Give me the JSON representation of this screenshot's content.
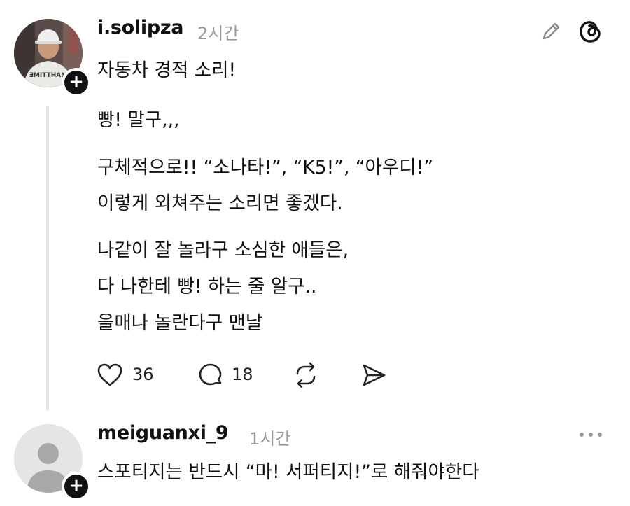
{
  "post": {
    "username": "i.solipza",
    "time": "2시간",
    "lines": {
      "l1": "자동차 경적 소리!",
      "l2": "빵! 말구,,,",
      "l3": "구체적으로!! “소나타!”, “K5!”, “아우디!”",
      "l4": "이렇게 외쳐주는 소리면 좋겠다.",
      "l5": "나같이 잘 놀라구 소심한 애들은,",
      "l6": "다 나한테 빵! 하는 줄 알구..",
      "l7": "을매나 놀란다구 맨날"
    },
    "avatar_shirt_text": "ƎMITTHAM",
    "likes": "36",
    "comments": "18"
  },
  "reply": {
    "username": "meiguanxi_9",
    "time": "1시간",
    "text": "스포티지는 반드시 “마! 서퍼티지!”로 해줘야한다"
  },
  "icons": {
    "edit": "pencil-icon",
    "threads": "threads-logo-icon",
    "like": "heart-icon",
    "comment": "comment-bubble-icon",
    "repost": "repost-icon",
    "share": "send-icon",
    "more": "more-dots-icon",
    "follow": "plus-icon"
  }
}
